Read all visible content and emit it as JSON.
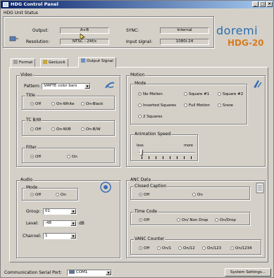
{
  "window": {
    "title": "HDG Control Panel",
    "min": "_",
    "max": "□",
    "close": "×"
  },
  "unit_status": {
    "label": "HDG Unit Status",
    "output_label": "Output:",
    "output_value": "A+B",
    "resolution_label": "Resolution:",
    "resolution_value": "NTSC - 24f/s",
    "sync_label": "SYNC:",
    "sync_value": "Internal",
    "input_label": "Input signal:",
    "input_value": "1080i-24"
  },
  "brand": {
    "name": "doremi",
    "model": "HDG-20"
  },
  "tabs": [
    {
      "label": "Format"
    },
    {
      "label": "GenLock"
    },
    {
      "label": "Output Signal"
    }
  ],
  "video": {
    "label": "Video",
    "pattern_label": "Pattern:",
    "pattern_value": "SMPTE color bars",
    "title_group": {
      "label": "Title",
      "options": [
        "Off",
        "On-White",
        "On-Black"
      ]
    },
    "tc_group": {
      "label": "TC B/W",
      "options": [
        "Off",
        "On-W/B",
        "On-B/W"
      ]
    },
    "filter_group": {
      "label": "Filter",
      "options": [
        "Off",
        "On"
      ]
    }
  },
  "motion": {
    "label": "Motion",
    "mode_label": "Mode",
    "modes": [
      "No Motion",
      "Square #1",
      "Square #2",
      "Inverted Squares",
      "Full Motion",
      "Snow",
      "2 Squares"
    ],
    "anim_label": "Animation Speed",
    "less": "less",
    "more": "more"
  },
  "audio": {
    "label": "Audio",
    "mode_label": "Mode",
    "mode_options": [
      "Off",
      "On"
    ],
    "group_label": "Group:",
    "group_value": "01",
    "level_label": "Level:",
    "level_value": "-48",
    "level_unit": "dB",
    "channel_label": "Channel:",
    "channel_value": "1"
  },
  "anc": {
    "label": "ANC Data",
    "cc_label": "Closed Caption",
    "cc_options": [
      "Off",
      "On"
    ],
    "tc_label": "Time Code",
    "tc_options": [
      "Off",
      "On/ Non Drop",
      "On/Drop"
    ],
    "vanc_label": "VANC Counter",
    "vanc_options": [
      "Off",
      "On/1",
      "On/12",
      "On/123",
      "On/1234"
    ]
  },
  "footer": {
    "port_label": "Communication Serial Port:",
    "port_value": "COM1",
    "settings_button": "System Settings..."
  }
}
